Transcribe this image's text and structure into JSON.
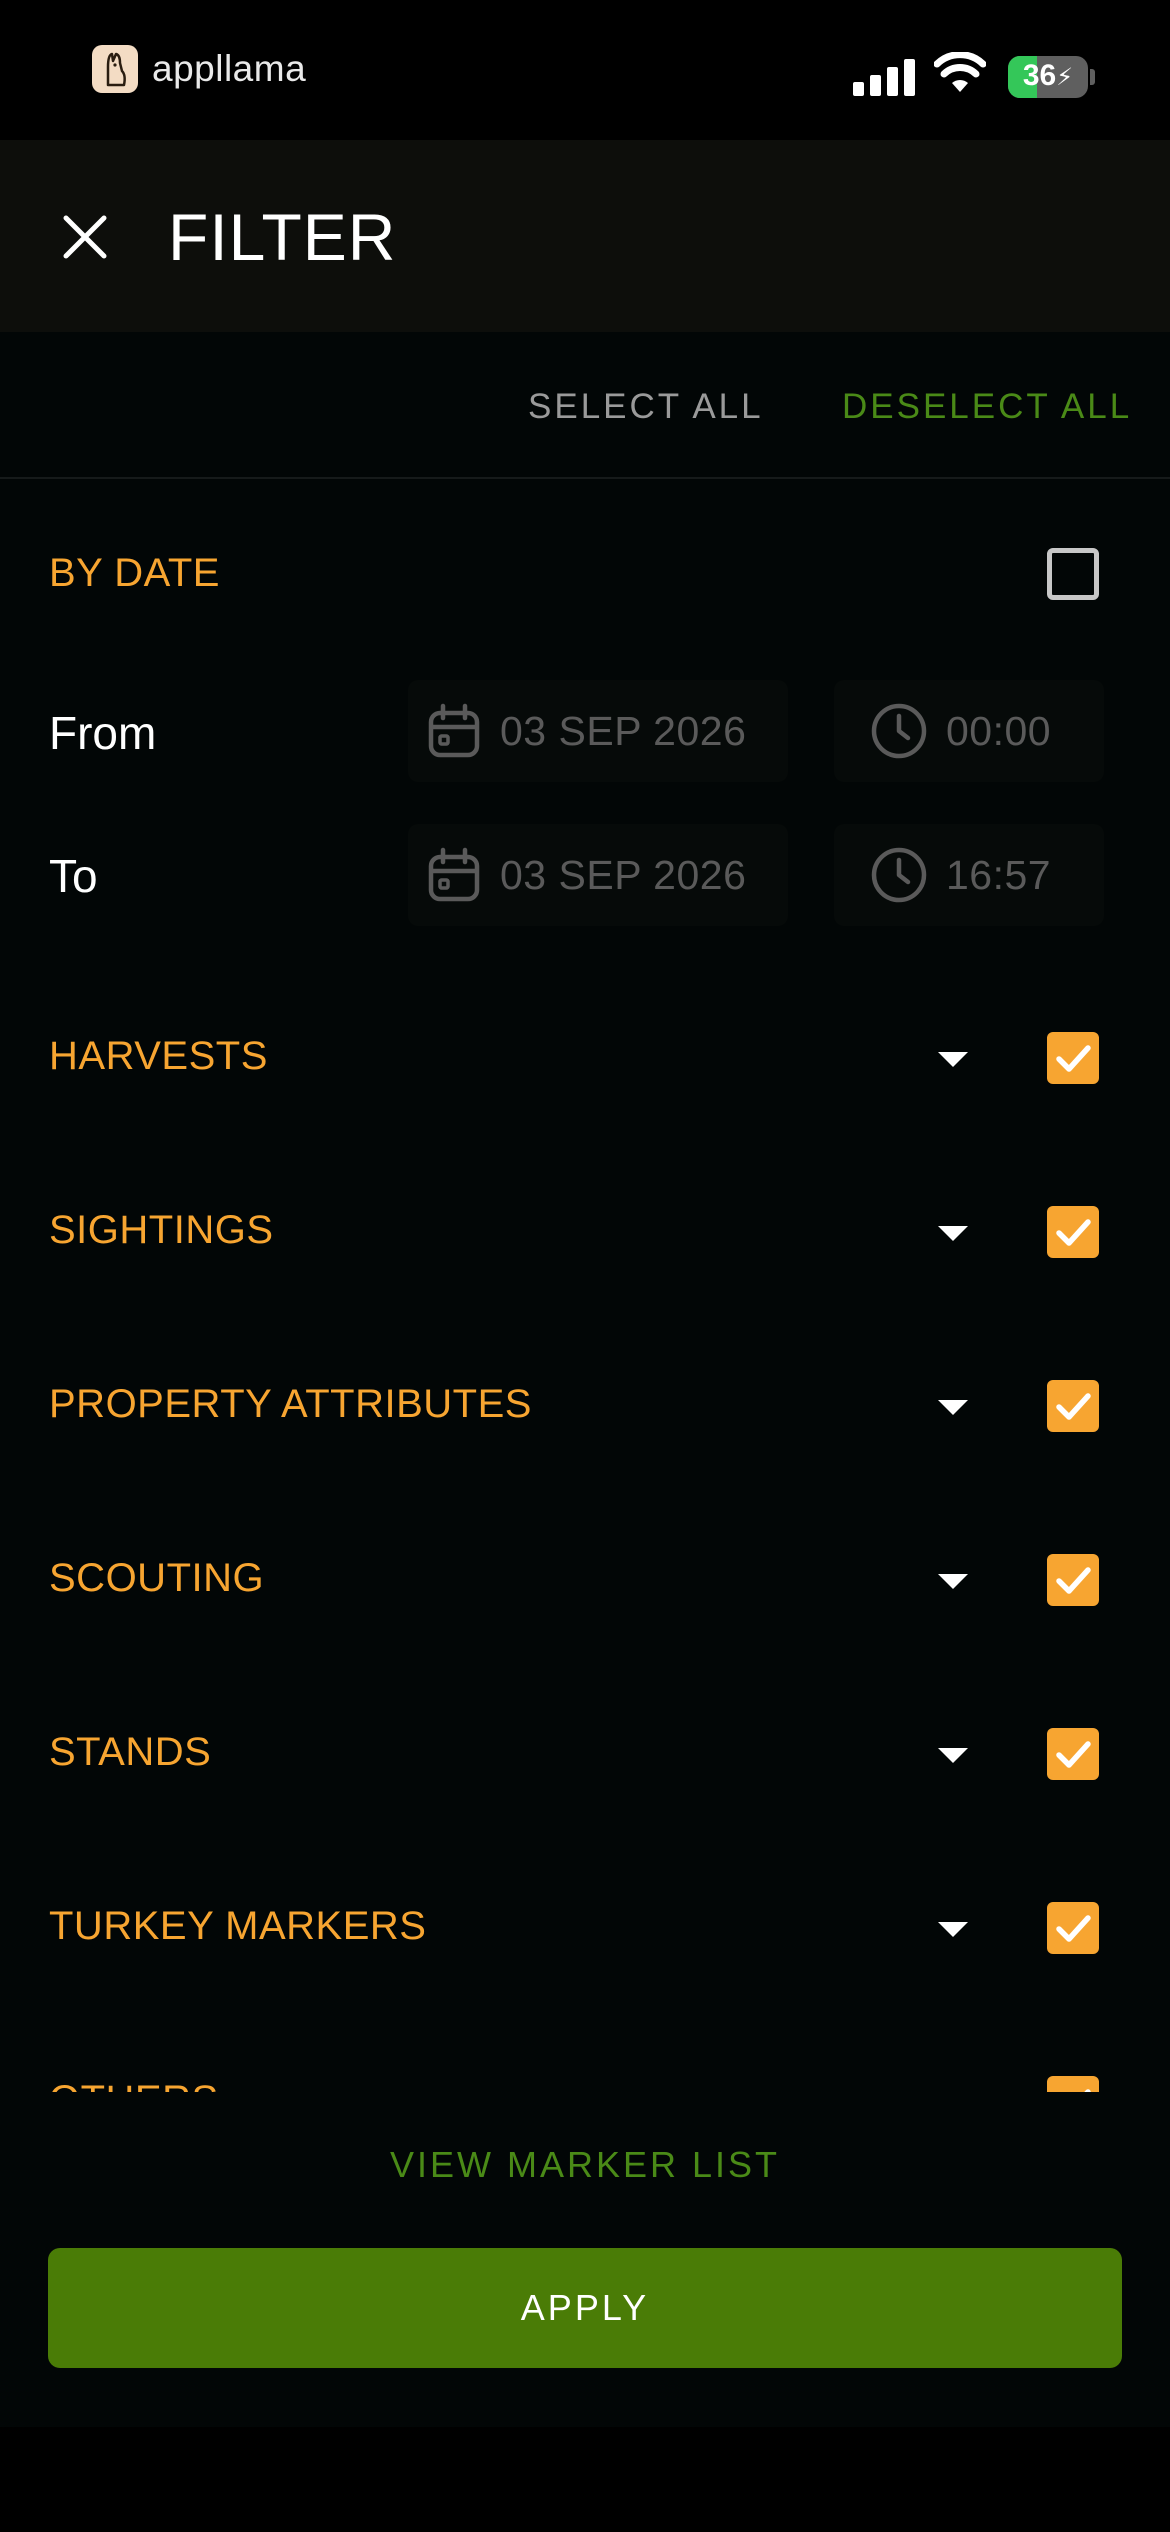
{
  "status_bar": {
    "brand": "appllama",
    "battery": "36",
    "battery_level": 0.36
  },
  "header": {
    "title": "FILTER",
    "close_icon": "close-icon"
  },
  "toolbar": {
    "select_all": "SELECT ALL",
    "deselect_all": "DESELECT ALL"
  },
  "by_date": {
    "label": "BY DATE",
    "checked": false,
    "from": {
      "label": "From",
      "date": "03 SEP 2026",
      "time": "00:00"
    },
    "to": {
      "label": "To",
      "date": "03 SEP 2026",
      "time": "16:57"
    }
  },
  "categories": [
    {
      "label": "HARVESTS",
      "checked": true
    },
    {
      "label": "SIGHTINGS",
      "checked": true
    },
    {
      "label": "PROPERTY ATTRIBUTES",
      "checked": true
    },
    {
      "label": "SCOUTING",
      "checked": true
    },
    {
      "label": "STANDS",
      "checked": true
    },
    {
      "label": "TURKEY MARKERS",
      "checked": true
    },
    {
      "label": "OTHERS",
      "checked": true
    }
  ],
  "footer": {
    "view_marker_list": "VIEW MARKER LIST",
    "apply": "APPLY"
  },
  "colors": {
    "accent_orange": "#f7a531",
    "accent_green": "#4a8a17",
    "apply_green": "#4a7c06"
  }
}
